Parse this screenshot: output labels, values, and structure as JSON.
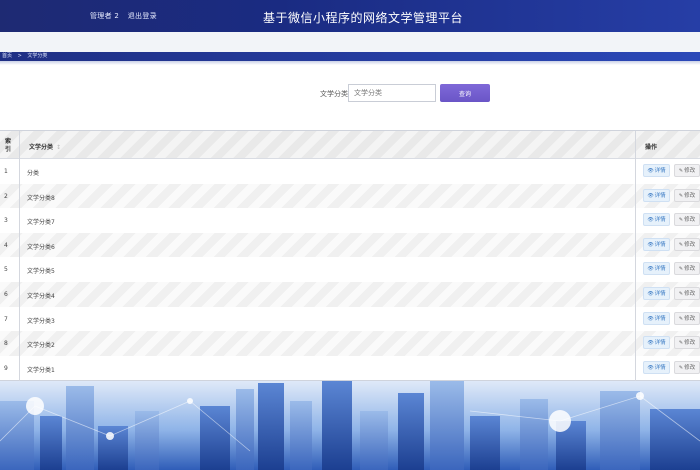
{
  "header": {
    "user_label": "管理者 2",
    "logout_label": "退出登录",
    "title": "基于微信小程序的网络文学管理平台"
  },
  "breadcrumb": {
    "home": "首页",
    "separator": ">",
    "current": "文学分类"
  },
  "search": {
    "label": "文学分类",
    "placeholder": "文学分类",
    "button_label": "查询"
  },
  "table": {
    "columns": {
      "index": "索引",
      "category": "文学分类",
      "sort_icon": "↕",
      "ops": "操作"
    },
    "detail_label": "详情",
    "edit_label": "修改",
    "rows": [
      {
        "index": "1",
        "category": "分类"
      },
      {
        "index": "2",
        "category": "文学分类8"
      },
      {
        "index": "3",
        "category": "文学分类7"
      },
      {
        "index": "4",
        "category": "文学分类6"
      },
      {
        "index": "5",
        "category": "文学分类5"
      },
      {
        "index": "6",
        "category": "文学分类4"
      },
      {
        "index": "7",
        "category": "文学分类3"
      },
      {
        "index": "8",
        "category": "文学分类2"
      },
      {
        "index": "9",
        "category": "文学分类1"
      }
    ]
  },
  "colors": {
    "header": "#1e2a73",
    "search_button": "#6a55c7",
    "detail_button": "#3c7bc4"
  }
}
